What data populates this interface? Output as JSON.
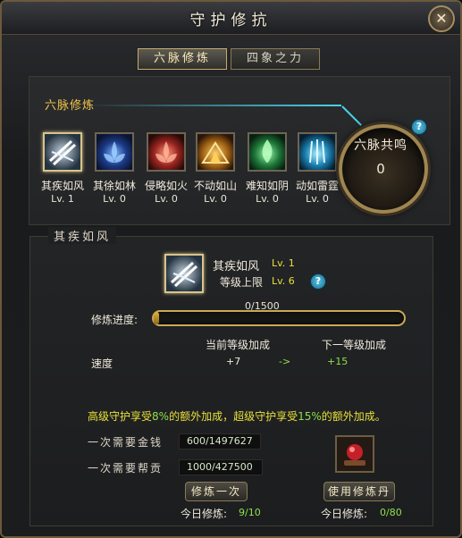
{
  "window": {
    "title": "守护修抗",
    "close_glyph": "✕"
  },
  "tabs": [
    {
      "label": "六脉修炼",
      "active": true
    },
    {
      "label": "四象之力",
      "active": false
    }
  ],
  "section": {
    "title": "六脉修炼"
  },
  "skills": [
    {
      "name": "其疾如风",
      "level": "Lv. 1",
      "icon": "wind-sword-icon",
      "color": "#c8d6e0"
    },
    {
      "name": "其徐如林",
      "level": "Lv. 0",
      "icon": "blue-lotus-icon",
      "color": "#3d78e0"
    },
    {
      "name": "侵略如火",
      "level": "Lv. 0",
      "icon": "red-lotus-icon",
      "color": "#d9453a"
    },
    {
      "name": "不动如山",
      "level": "Lv. 0",
      "icon": "golden-mountain-icon",
      "color": "#e0a02a"
    },
    {
      "name": "难知如阴",
      "level": "Lv. 0",
      "icon": "green-flame-icon",
      "color": "#3ac76a"
    },
    {
      "name": "动如雷霆",
      "level": "Lv. 0",
      "icon": "cyan-lightning-icon",
      "color": "#39b7e6"
    }
  ],
  "resonance": {
    "title": "六脉共鸣",
    "value": "0"
  },
  "detail": {
    "header": "其疾如风",
    "name": "其疾如风",
    "level": "Lv. 1",
    "cap_label": "等级上限",
    "cap_value": "Lv. 6",
    "progress_label": "修炼进度:",
    "progress_text": "0/1500",
    "progress_fraction": 0.02,
    "speed_label": "速度",
    "current_header": "当前等级加成",
    "next_header": "下一等级加成",
    "current_value": "+7",
    "arrow": "->",
    "next_value": "+15",
    "bonus_part1": "高级守护享受",
    "bonus_pct1": "8%",
    "bonus_part2": "的额外加成，超级守护享受",
    "bonus_pct2": "15%",
    "bonus_part3": "的额外加成。",
    "gold_label": "一次需要金钱",
    "gold_value": "600/1497627",
    "contrib_label": "一次需要帮贡",
    "contrib_value": "1000/427500",
    "train_button": "修炼一次",
    "pill_button": "使用修炼丹",
    "today_label_left": "今日修炼:",
    "today_value_left": "9/10",
    "today_label_right": "今日修炼:",
    "today_value_right": "0/80"
  },
  "colors": {
    "gold": "#f3c64a",
    "green": "#8fe04a",
    "cyan": "#49d3ee",
    "yellow": "#e8e03a"
  }
}
